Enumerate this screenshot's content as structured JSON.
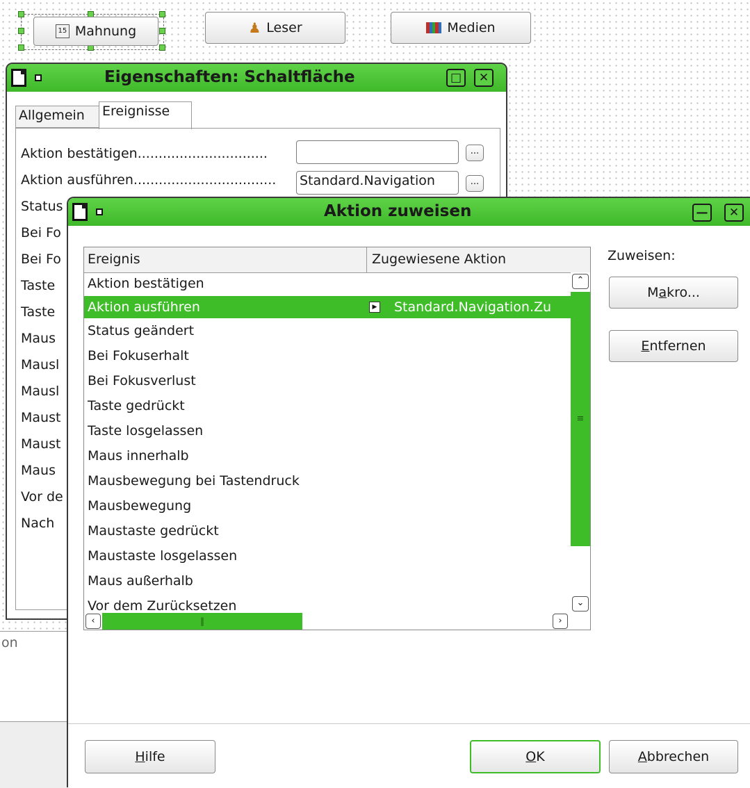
{
  "top_buttons": [
    {
      "label": "Mahnung",
      "icon": "calendar-icon"
    },
    {
      "label": "Leser",
      "icon": "people-icon"
    },
    {
      "label": "Medien",
      "icon": "books-icon"
    }
  ],
  "properties_dialog": {
    "title": "Eigenschaften: Schaltfläche",
    "tabs": [
      "Allgemein",
      "Ereignisse"
    ],
    "active_tab": "Ereignisse",
    "rows": [
      {
        "label": "Aktion bestätigen",
        "dots": "...............................",
        "value": ""
      },
      {
        "label": "Aktion ausführen",
        "dots": "..................................",
        "value": "Standard.Navigation"
      }
    ],
    "dots_button": "...",
    "clipped_labels": [
      "Status",
      "Bei Fo",
      "Bei Fo",
      "Taste",
      "Taste",
      "Maus",
      "Mausl",
      "Mausl",
      "Maust",
      "Maust",
      "Maus",
      "Vor de",
      "Nach"
    ]
  },
  "background_label": "on",
  "assign_dialog": {
    "title": "Aktion zuweisen",
    "columns": [
      "Ereignis",
      "Zugewiesene Aktion"
    ],
    "events": [
      {
        "name": "Aktion bestätigen",
        "action": ""
      },
      {
        "name": "Aktion ausführen",
        "action": "Standard.Navigation.Zu",
        "selected": true
      },
      {
        "name": "Status geändert",
        "action": ""
      },
      {
        "name": "Bei Fokuserhalt",
        "action": ""
      },
      {
        "name": "Bei Fokusverlust",
        "action": ""
      },
      {
        "name": "Taste gedrückt",
        "action": ""
      },
      {
        "name": "Taste losgelassen",
        "action": ""
      },
      {
        "name": "Maus innerhalb",
        "action": ""
      },
      {
        "name": "Mausbewegung bei Tastendruck",
        "action": ""
      },
      {
        "name": "Mausbewegung",
        "action": ""
      },
      {
        "name": "Maustaste gedrückt",
        "action": ""
      },
      {
        "name": "Maustaste losgelassen",
        "action": ""
      },
      {
        "name": "Maus außerhalb",
        "action": ""
      },
      {
        "name": "Vor dem Zurücksetzen",
        "action": ""
      }
    ],
    "assign_label": "Zuweisen:",
    "macro_button": {
      "pre": "M",
      "u": "a",
      "post": "kro..."
    },
    "remove_button": {
      "pre": "",
      "u": "E",
      "post": "ntfernen"
    },
    "help_button": {
      "pre": "",
      "u": "H",
      "post": "ilfe"
    },
    "ok_button": {
      "pre": "",
      "u": "O",
      "post": "K"
    },
    "cancel_button": {
      "pre": "",
      "u": "A",
      "post": "bbrechen"
    }
  },
  "colors": {
    "accent": "#3fbd29",
    "titlebar": "#4ec737"
  }
}
